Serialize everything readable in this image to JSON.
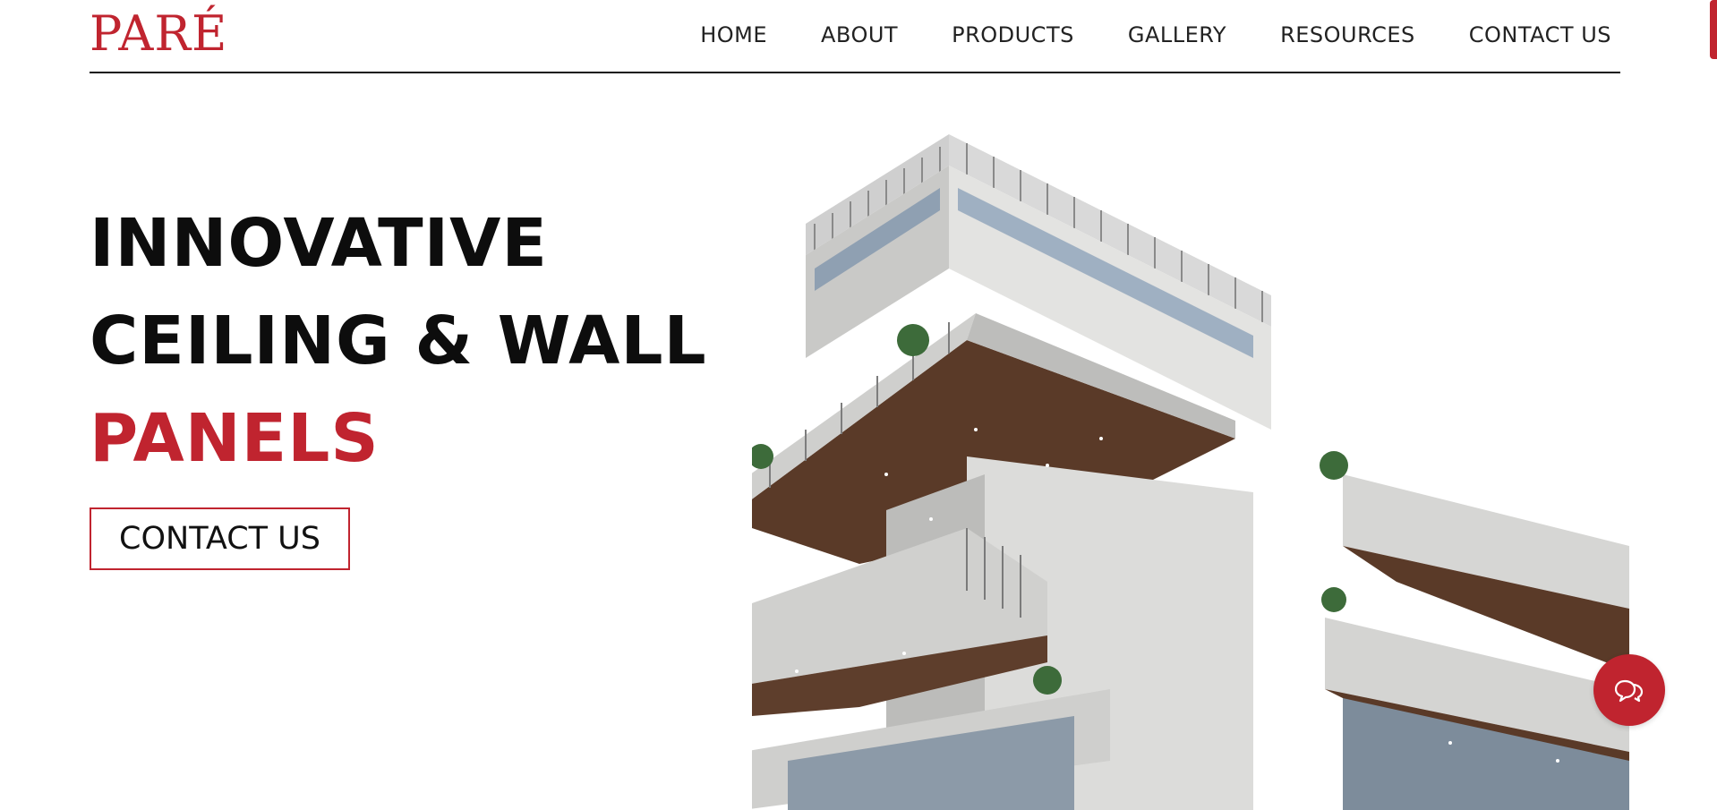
{
  "brand": {
    "logo_text": "PARÉ",
    "accent_color": "#c0242f"
  },
  "nav": {
    "items": [
      {
        "label": "HOME"
      },
      {
        "label": "ABOUT"
      },
      {
        "label": "PRODUCTS"
      },
      {
        "label": "GALLERY"
      },
      {
        "label": "RESOURCES"
      },
      {
        "label": "CONTACT US"
      }
    ]
  },
  "hero": {
    "title_line1": "INNOVATIVE",
    "title_line2": "CEILING & WALL",
    "title_line3": "PANELS",
    "cta_label": "CONTACT US"
  },
  "icons": {
    "chat": "chat-bubble-icon"
  }
}
